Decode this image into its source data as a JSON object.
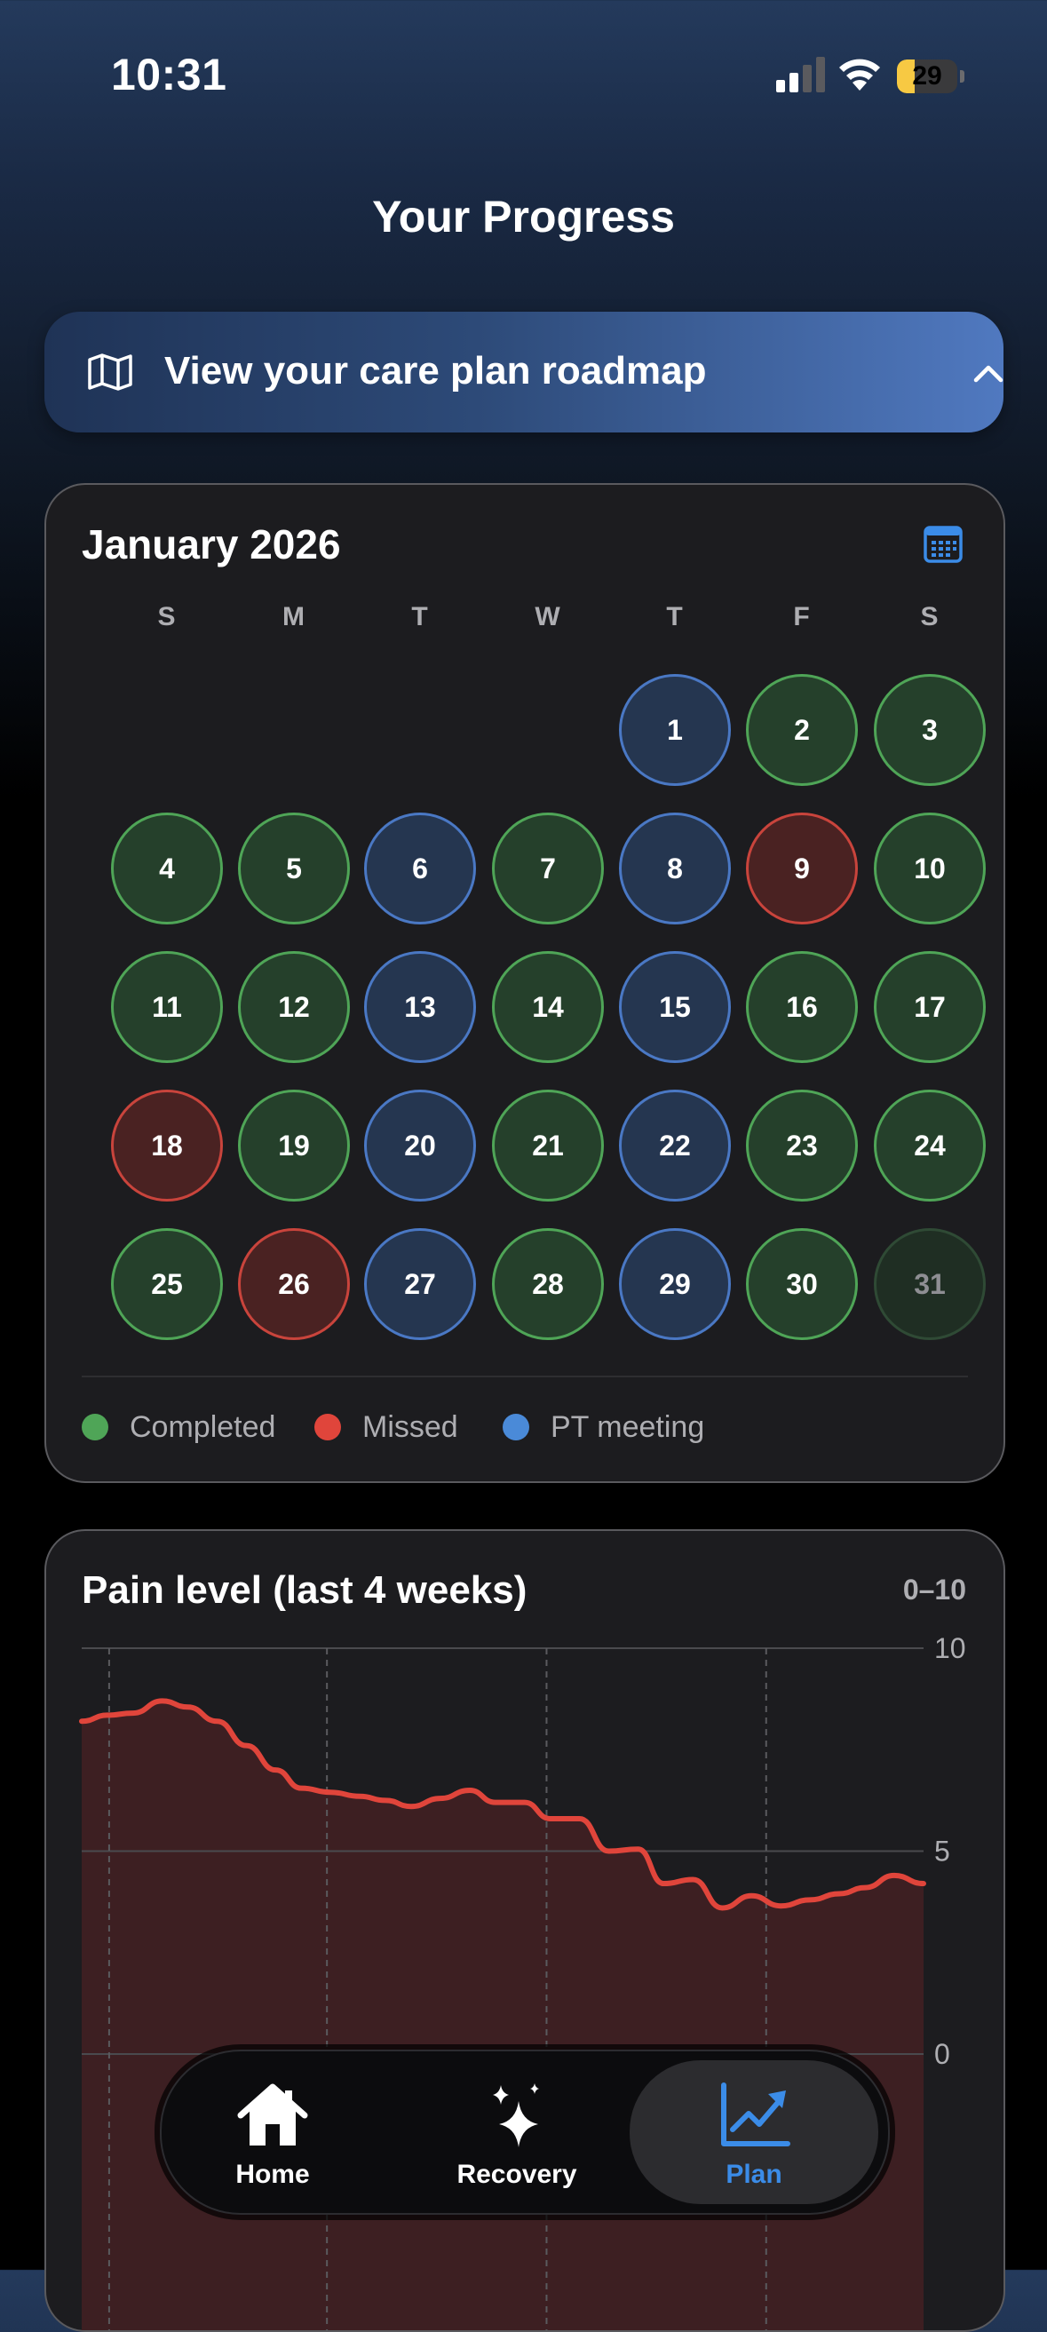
{
  "status_bar": {
    "time": "10:31",
    "battery_percent": "29",
    "battery_level": 0.29
  },
  "page": {
    "title": "Your Progress"
  },
  "roadmap_banner": {
    "label": "View your care plan roadmap",
    "icon": "map-icon",
    "toggle_icon": "chevron-up-icon"
  },
  "calendar": {
    "month_title": "January 2026",
    "icon": "calendar-icon",
    "weekdays": [
      "S",
      "M",
      "T",
      "W",
      "T",
      "F",
      "S"
    ],
    "first_weekday_index": 4,
    "days": [
      {
        "day": "1",
        "status": "pt"
      },
      {
        "day": "2",
        "status": "completed"
      },
      {
        "day": "3",
        "status": "completed"
      },
      {
        "day": "4",
        "status": "completed"
      },
      {
        "day": "5",
        "status": "completed"
      },
      {
        "day": "6",
        "status": "pt"
      },
      {
        "day": "7",
        "status": "completed"
      },
      {
        "day": "8",
        "status": "pt"
      },
      {
        "day": "9",
        "status": "missed"
      },
      {
        "day": "10",
        "status": "completed"
      },
      {
        "day": "11",
        "status": "completed"
      },
      {
        "day": "12",
        "status": "completed"
      },
      {
        "day": "13",
        "status": "pt"
      },
      {
        "day": "14",
        "status": "completed"
      },
      {
        "day": "15",
        "status": "pt"
      },
      {
        "day": "16",
        "status": "completed"
      },
      {
        "day": "17",
        "status": "completed"
      },
      {
        "day": "18",
        "status": "missed"
      },
      {
        "day": "19",
        "status": "completed"
      },
      {
        "day": "20",
        "status": "pt"
      },
      {
        "day": "21",
        "status": "completed"
      },
      {
        "day": "22",
        "status": "pt"
      },
      {
        "day": "23",
        "status": "completed"
      },
      {
        "day": "24",
        "status": "completed"
      },
      {
        "day": "25",
        "status": "completed"
      },
      {
        "day": "26",
        "status": "missed"
      },
      {
        "day": "27",
        "status": "pt"
      },
      {
        "day": "28",
        "status": "completed"
      },
      {
        "day": "29",
        "status": "pt"
      },
      {
        "day": "30",
        "status": "completed"
      },
      {
        "day": "31",
        "status": "dim"
      }
    ],
    "legend": [
      {
        "label": "Completed",
        "color": "#4fa557"
      },
      {
        "label": "Missed",
        "color": "#e0453b"
      },
      {
        "label": "PT meeting",
        "color": "#4a8ad8"
      }
    ]
  },
  "pain_chart": {
    "title": "Pain level (last 4 weeks)",
    "range_label": "0–10",
    "colors": {
      "line": "#e0453b",
      "fill": "#3d1f22"
    },
    "chart_data": {
      "type": "area",
      "title": "Pain level (last 4 weeks)",
      "ylim": [
        0,
        10
      ],
      "y_ticks": [
        "10",
        "5",
        "0"
      ],
      "grid": true,
      "points": [
        [
          0,
          8.2
        ],
        [
          0.7,
          8.35
        ],
        [
          1.4,
          8.4
        ],
        [
          2.2,
          8.7
        ],
        [
          2.9,
          8.55
        ],
        [
          3.7,
          8.2
        ],
        [
          4.5,
          7.6
        ],
        [
          5.3,
          7.0
        ],
        [
          6.0,
          6.55
        ],
        [
          6.8,
          6.45
        ],
        [
          7.6,
          6.35
        ],
        [
          8.3,
          6.25
        ],
        [
          9.0,
          6.1
        ],
        [
          9.8,
          6.3
        ],
        [
          10.6,
          6.5
        ],
        [
          11.3,
          6.2
        ],
        [
          12.1,
          6.2
        ],
        [
          12.8,
          5.8
        ],
        [
          13.6,
          5.8
        ],
        [
          14.4,
          5.0
        ],
        [
          15.2,
          5.05
        ],
        [
          15.9,
          4.2
        ],
        [
          16.7,
          4.3
        ],
        [
          17.5,
          3.6
        ],
        [
          18.3,
          3.9
        ],
        [
          19.1,
          3.65
        ],
        [
          19.9,
          3.8
        ],
        [
          20.7,
          3.95
        ],
        [
          21.4,
          4.1
        ],
        [
          22.2,
          4.4
        ],
        [
          23.0,
          4.2
        ]
      ],
      "x_range": [
        0,
        23
      ],
      "week_dividers": [
        0.75,
        6.7,
        12.7,
        18.7
      ]
    }
  },
  "tab_bar": {
    "tabs": [
      {
        "label": "Home",
        "icon": "home-icon"
      },
      {
        "label": "Recovery",
        "icon": "sparkles-icon"
      },
      {
        "label": "Plan",
        "icon": "chart-line-icon",
        "active": true
      }
    ]
  }
}
